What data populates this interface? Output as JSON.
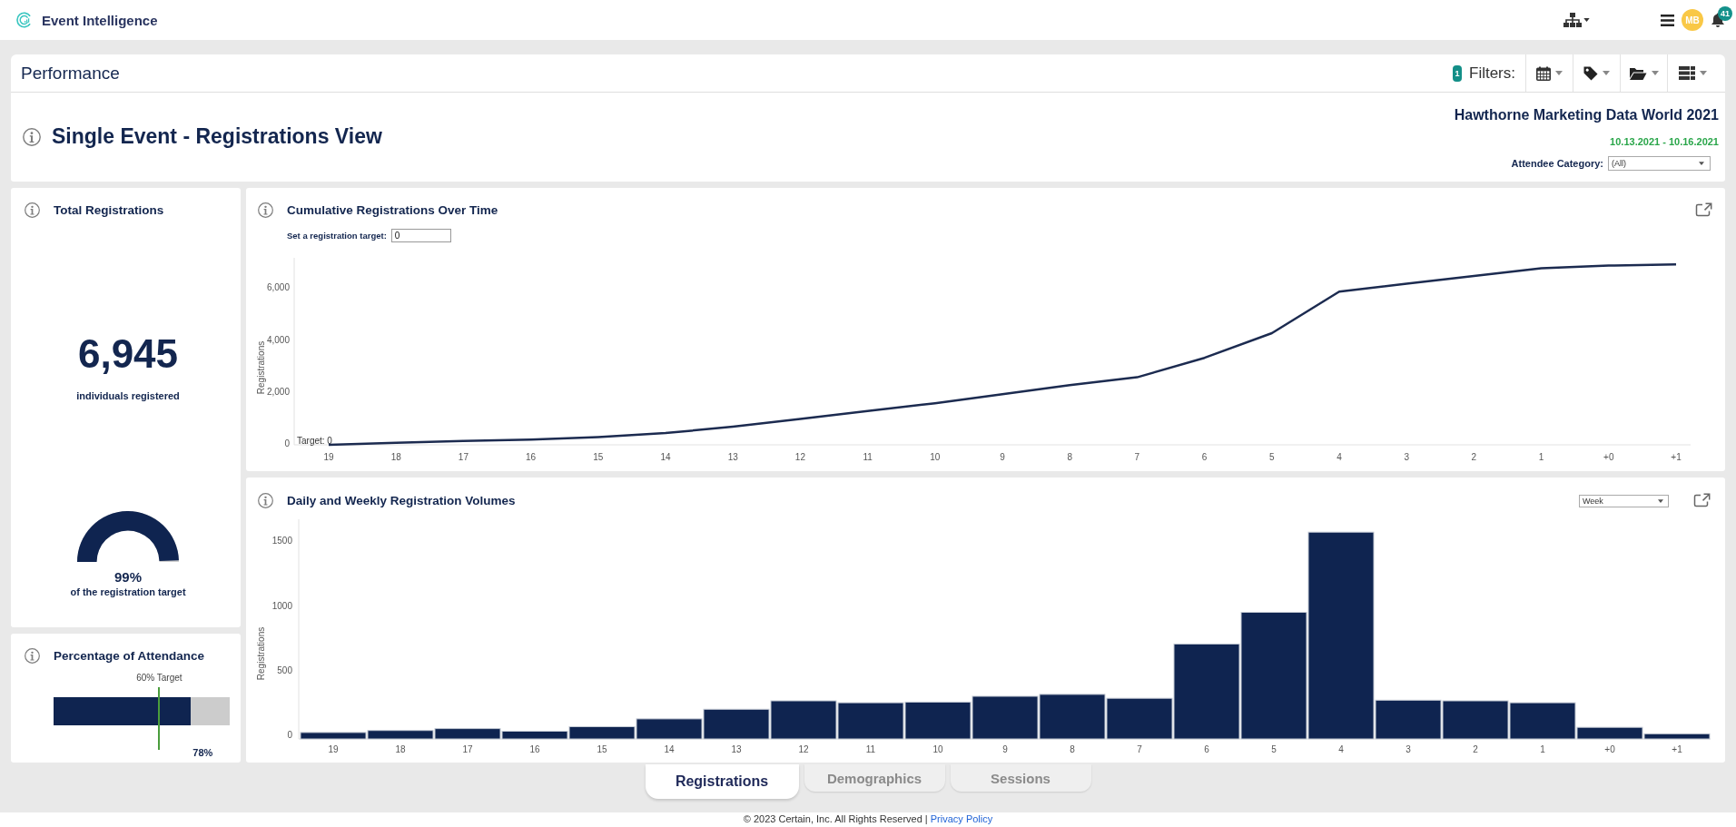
{
  "top_bar": {
    "brand": "Event Intelligence",
    "avatar_initials": "MB",
    "notification_count": "41"
  },
  "page_header": {
    "title": "Performance",
    "filter_count": "1",
    "filter_label": "Filters:"
  },
  "view": {
    "title": "Single Event - Registrations View",
    "event_name": "Hawthorne Marketing Data World 2021",
    "event_dates": "10.13.2021 - 10.16.2021",
    "attendee_category": {
      "label": "Attendee Category:",
      "value": "(All)"
    }
  },
  "total_registrations": {
    "title": "Total Registrations",
    "value": "6,945",
    "caption": "individuals registered",
    "gauge": {
      "level": 0.99,
      "reading": "99%",
      "caption": "of the registration target"
    }
  },
  "attendance": {
    "title": "Percentage of Attendance",
    "level": 0.78,
    "reading": "78%",
    "target": {
      "label": "60% Target",
      "level": 0.6
    }
  },
  "cumulative_chart": {
    "title": "Cumulative Registrations Over Time",
    "target_field": {
      "label": "Set a registration target:",
      "value": "0"
    },
    "chart_data": {
      "type": "line",
      "ylabel": "Registrations",
      "categories": [
        "19",
        "18",
        "17",
        "16",
        "15",
        "14",
        "13",
        "12",
        "11",
        "10",
        "9",
        "8",
        "7",
        "6",
        "5",
        "4",
        "3",
        "2",
        "1",
        "+0",
        "+1"
      ],
      "values": [
        0,
        80,
        150,
        200,
        300,
        450,
        700,
        1000,
        1300,
        1600,
        1950,
        2300,
        2600,
        3350,
        4300,
        5900,
        6200,
        6500,
        6800,
        6900,
        6950
      ],
      "ylim": [
        0,
        7200
      ],
      "yticks": [
        0,
        {
          "value": 2000,
          "label": "2,000"
        },
        {
          "value": 4000,
          "label": "4,000"
        },
        {
          "value": 6000,
          "label": "6,000"
        }
      ],
      "annotations": [
        "Target: 0"
      ]
    }
  },
  "volume_chart": {
    "title": "Daily and Weekly Registration Volumes",
    "period": {
      "value": "Week"
    },
    "chart_data": {
      "type": "bar",
      "ylabel": "Registrations",
      "categories": [
        "19",
        "18",
        "17",
        "16",
        "15",
        "14",
        "13",
        "12",
        "11",
        "10",
        "9",
        "8",
        "7",
        "6",
        "5",
        "4",
        "3",
        "2",
        "1",
        "+0",
        "+1"
      ],
      "values": [
        50,
        65,
        80,
        60,
        95,
        155,
        230,
        295,
        280,
        285,
        330,
        345,
        315,
        735,
        980,
        1600,
        300,
        295,
        280,
        90,
        40
      ],
      "ylim": [
        0,
        1700
      ],
      "yticks": [
        0,
        500,
        1000,
        1500
      ]
    }
  },
  "tabs": [
    {
      "label": "Registrations",
      "selected": true
    },
    {
      "label": "Demographics",
      "selected": false
    },
    {
      "label": "Sessions",
      "selected": false
    }
  ],
  "footer": {
    "text": "© 2023 Certain, Inc. All Rights Reserved |",
    "link": "Privacy Policy"
  }
}
